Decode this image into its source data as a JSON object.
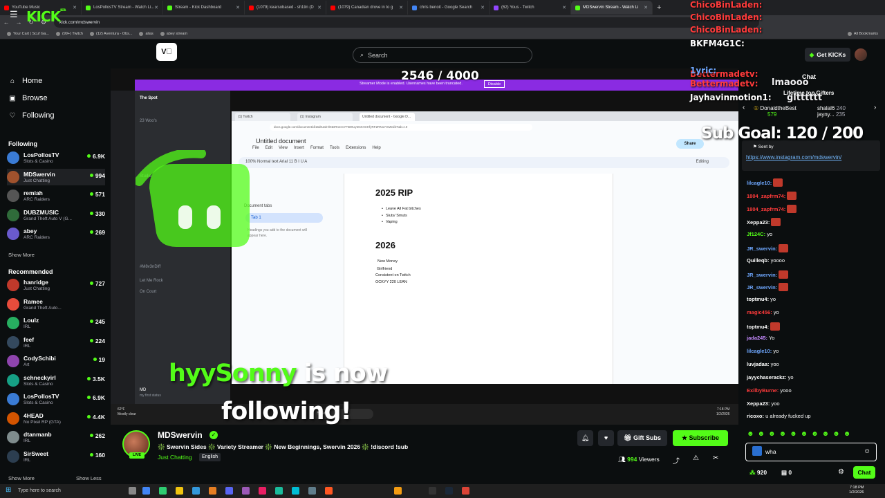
{
  "browser": {
    "tabs": [
      {
        "label": "YouTube Music",
        "color": "#ff0000"
      },
      {
        "label": "LosPollosTV Stream - Watch Li...",
        "color": "#53fc18"
      },
      {
        "label": "Stream - Kick Dashboard",
        "color": "#53fc18"
      },
      {
        "label": "(1079) kearsobased - sh1tin (D",
        "color": "#ff0000"
      },
      {
        "label": "(1079) Canadian drove in to g",
        "color": "#ff0000"
      },
      {
        "label": "chris benoit - Google Search",
        "color": "#4285f4"
      },
      {
        "label": "(62) Yous - Twitch",
        "color": "#9146ff"
      },
      {
        "label": "MDSwervin Stream - Watch Li",
        "color": "#53fc18"
      }
    ],
    "url": "kick.com/mdswervin",
    "gemini": "Gemini",
    "bookmarks": [
      "Your Cart | Scuf Ga...",
      "(99+) Twitch",
      "(12) Aventura - Obs...",
      "alias",
      "abey stream"
    ],
    "all_bookmarks": "All Bookmarks"
  },
  "kick": {
    "logo": "KICK",
    "logo_beta": "BETA",
    "search_placeholder": "Search",
    "get_kicks": "Get KICKs",
    "nav": {
      "home": "Home",
      "browse": "Browse",
      "following": "Following"
    },
    "following_heading": "Following",
    "recommended_heading": "Recommended",
    "show_more": "Show More",
    "show_less": "Show Less",
    "following": [
      {
        "name": "LosPollosTV",
        "cat": "Slots & Casino",
        "viewers": "6.9K",
        "color": "#3a7bd5"
      },
      {
        "name": "MDSwervin",
        "cat": "Just Chatting",
        "viewers": "994",
        "color": "#a0522d"
      },
      {
        "name": "remiah",
        "cat": "ARC Raiders",
        "viewers": "571",
        "color": "#555"
      },
      {
        "name": "DUBZMUSIC",
        "cat": "Grand Theft Auto V (G...",
        "viewers": "330",
        "color": "#2f6b3a"
      },
      {
        "name": "abey",
        "cat": "ARC Raiders",
        "viewers": "269",
        "color": "#6a5acd"
      }
    ],
    "recommended": [
      {
        "name": "hanridge",
        "cat": "Just Chatting",
        "viewers": "727",
        "color": "#c0392b"
      },
      {
        "name": "Ramee",
        "cat": "Grand Theft Auto...",
        "viewers": "",
        "color": "#e74c3c"
      },
      {
        "name": "Loulz",
        "cat": "IRL",
        "viewers": "245",
        "color": "#27ae60"
      },
      {
        "name": "feef",
        "cat": "IRL",
        "viewers": "224",
        "color": "#34495e"
      },
      {
        "name": "CodySchibi",
        "cat": "Art",
        "viewers": "19",
        "color": "#8e44ad"
      },
      {
        "name": "schneckyirl",
        "cat": "Slots & Casino",
        "viewers": "3.5K",
        "color": "#16a085"
      },
      {
        "name": "LosPollosTV",
        "cat": "Slots & Casino",
        "viewers": "6.9K",
        "color": "#3a7bd5"
      },
      {
        "name": "4HEAD",
        "cat": "No Pixel RP (GTA)",
        "viewers": "4.4K",
        "color": "#d35400"
      },
      {
        "name": "dtanmanb",
        "cat": "IRL",
        "viewers": "262",
        "color": "#7f8c8d"
      },
      {
        "name": "SirSweet",
        "cat": "IRL",
        "viewers": "160",
        "color": "#2c3e50"
      }
    ]
  },
  "stream": {
    "counter": "2546 / 4000",
    "streamer_mode": "Streamer Mode is enabled. Usernames have been truncated.",
    "disable": "Disable",
    "doc": {
      "tabs": [
        "(1) Twitch",
        "(1) Instagram",
        "Untitled document - Google D..."
      ],
      "url": "docs.google.com/document/d/15dKasiHkNDRnenvYFBWUyDnKHXHfyRFZRN1YGMedit?tab=t.0",
      "title": "Untitled document",
      "menu": [
        "File",
        "Edit",
        "View",
        "Insert",
        "Format",
        "Tools",
        "Extensions",
        "Help"
      ],
      "toolbar": "100%   Normal text   Arial   11   B  I  U  A",
      "share": "Share",
      "editing": "Editing",
      "doc_tabs_label": "Document tabs",
      "tab1": "Tab 1",
      "tab_hint": "Headings you add to the document will appear here.",
      "h1": "2025 RIP",
      "list1": [
        "Leave All Fat bitches",
        "Sluts/ Smuts",
        "Vaping"
      ],
      "h2": "2026",
      "lines2": [
        "New Money",
        "Girlfriend",
        "Consistent on Twitch",
        "OCKYY 220 LEAN"
      ]
    },
    "discord": {
      "server": "The Spot",
      "channels": [
        "23 Woo's",
        "Studio",
        "#M8v3nDiff",
        "Let Me Rock",
        "On Court"
      ],
      "user": "MD",
      "status": "my first status"
    },
    "taskbar_search": "Search",
    "weather": {
      "temp": "62°F",
      "desc": "Mostly clear"
    },
    "clock": {
      "time": "7:18 PM",
      "date": "1/2/2026"
    },
    "follow_alert": {
      "name": "hyySonny",
      "text1": "is now",
      "text2": "following!"
    }
  },
  "overlay": {
    "names": [
      {
        "name": "ChicoBinLaden:",
        "color": "#ff3b3b"
      },
      {
        "name": "ChicoBinLaden:",
        "color": "#ff3b3b"
      },
      {
        "name": "ChicoBinLaden:",
        "color": "#ff3b3b"
      },
      {
        "name": "BKFM4G1C:",
        "color": "#ffffff"
      },
      {
        "name": "Bettermadetv:",
        "color": "#ff3b3b"
      },
      {
        "name": "1yric:",
        "color": "#6fa8ff"
      },
      {
        "name": "Bettermadetv:",
        "color": "#ff3b3b"
      },
      {
        "name": "Jayhavinmotion1:",
        "color": "#ffffff"
      }
    ],
    "msg_lmaooo": "lmaooo",
    "msg_gltt": "gltttttt",
    "sub_goal": "Sub Goal: 120 / 200"
  },
  "info": {
    "name": "MDSwervin",
    "live": "LIVE",
    "title": "❇️ Swervin Sides ❇️ Variety Streamer ❇️ New Beginnings, Swervin 2026 ❇️ !discord !sub",
    "category": "Just Chatting",
    "language": "English",
    "gift_subs": "Gift Subs",
    "subscribe": "Subscribe",
    "viewers": "994",
    "viewers_label": "Viewers"
  },
  "chat": {
    "header": "Chat",
    "gifters_heading": "Lifetime top Gifters",
    "gifters": [
      {
        "name": "DonaldtheBest",
        "count": "579"
      },
      {
        "name": "shalal6",
        "count": "240"
      },
      {
        "name": "jayny...",
        "count": "235"
      }
    ],
    "pinned_sent_by": "Sent by",
    "pinned_link": "https://www.instagram.com/mdswervin/",
    "messages": [
      {
        "user": "lilcagle10:",
        "color": "#6fa8ff",
        "text": ""
      },
      {
        "user": "1804_zapfrm74:",
        "color": "#ff3b3b",
        "text": ""
      },
      {
        "user": "1804_zapfrm74:",
        "color": "#ff3b3b",
        "text": ""
      },
      {
        "user": "Xeppa23:",
        "color": "#fff",
        "text": ""
      },
      {
        "user": "Jf124C:",
        "color": "#53fc18",
        "text": "yo"
      },
      {
        "user": "JR_swervin:",
        "color": "#6fa8ff",
        "text": ""
      },
      {
        "user": "Quilleqb:",
        "color": "#fff",
        "text": "yoooo"
      },
      {
        "user": "JR_swervin:",
        "color": "#6fa8ff",
        "text": ""
      },
      {
        "user": "JR_swervin:",
        "color": "#6fa8ff",
        "text": ""
      },
      {
        "user": "toptmu4:",
        "color": "#fff",
        "text": "yo"
      },
      {
        "user": "magic456:",
        "color": "#ff3b3b",
        "text": "yo"
      },
      {
        "user": "toptmu4:",
        "color": "#fff",
        "text": ""
      },
      {
        "user": "jada245:",
        "color": "#c58aff",
        "text": "Yo"
      },
      {
        "user": "lilcagle10:",
        "color": "#6fa8ff",
        "text": "yo"
      },
      {
        "user": "luvjadaa:",
        "color": "#fff",
        "text": "yoo"
      },
      {
        "user": "jayychaserackz:",
        "color": "#fff",
        "text": "yo"
      },
      {
        "user": "ExilbyBurne:",
        "color": "#ff3b3b",
        "text": "yooo"
      },
      {
        "user": "Xeppa23:",
        "color": "#fff",
        "text": "yoo"
      },
      {
        "user": "ricoxo:",
        "color": "#fff",
        "text": "u already fucked up"
      }
    ],
    "input_value": "wha",
    "points": "920",
    "boxes": "0",
    "send": "Chat"
  },
  "windows": {
    "search": "Type here to search",
    "time": "7:18 PM",
    "date": "1/2/2026"
  }
}
